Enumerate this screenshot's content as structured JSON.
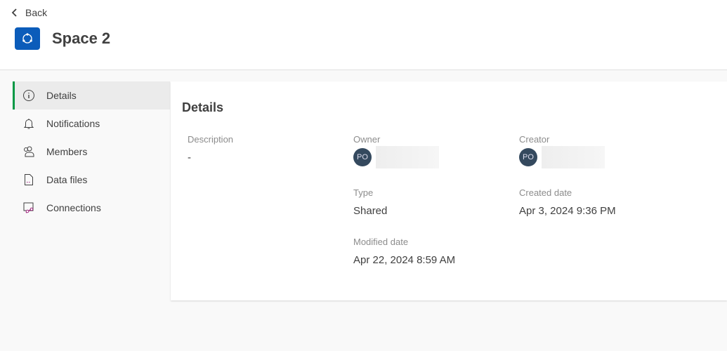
{
  "header": {
    "back_label": "Back",
    "title": "Space 2",
    "icon_color": "#0b5cba"
  },
  "sidebar": {
    "items": [
      {
        "label": "Details",
        "active": true
      },
      {
        "label": "Notifications"
      },
      {
        "label": "Members"
      },
      {
        "label": "Data files"
      },
      {
        "label": "Connections"
      }
    ],
    "accent": "#009845"
  },
  "details": {
    "heading": "Details",
    "description": {
      "label": "Description",
      "value": "-"
    },
    "owner": {
      "label": "Owner",
      "initials": "PO"
    },
    "creator": {
      "label": "Creator",
      "initials": "PO"
    },
    "type": {
      "label": "Type",
      "value": "Shared"
    },
    "created": {
      "label": "Created date",
      "value": "Apr 3, 2024 9:36 PM"
    },
    "modified": {
      "label": "Modified date",
      "value": "Apr 22, 2024 8:59 AM"
    }
  }
}
